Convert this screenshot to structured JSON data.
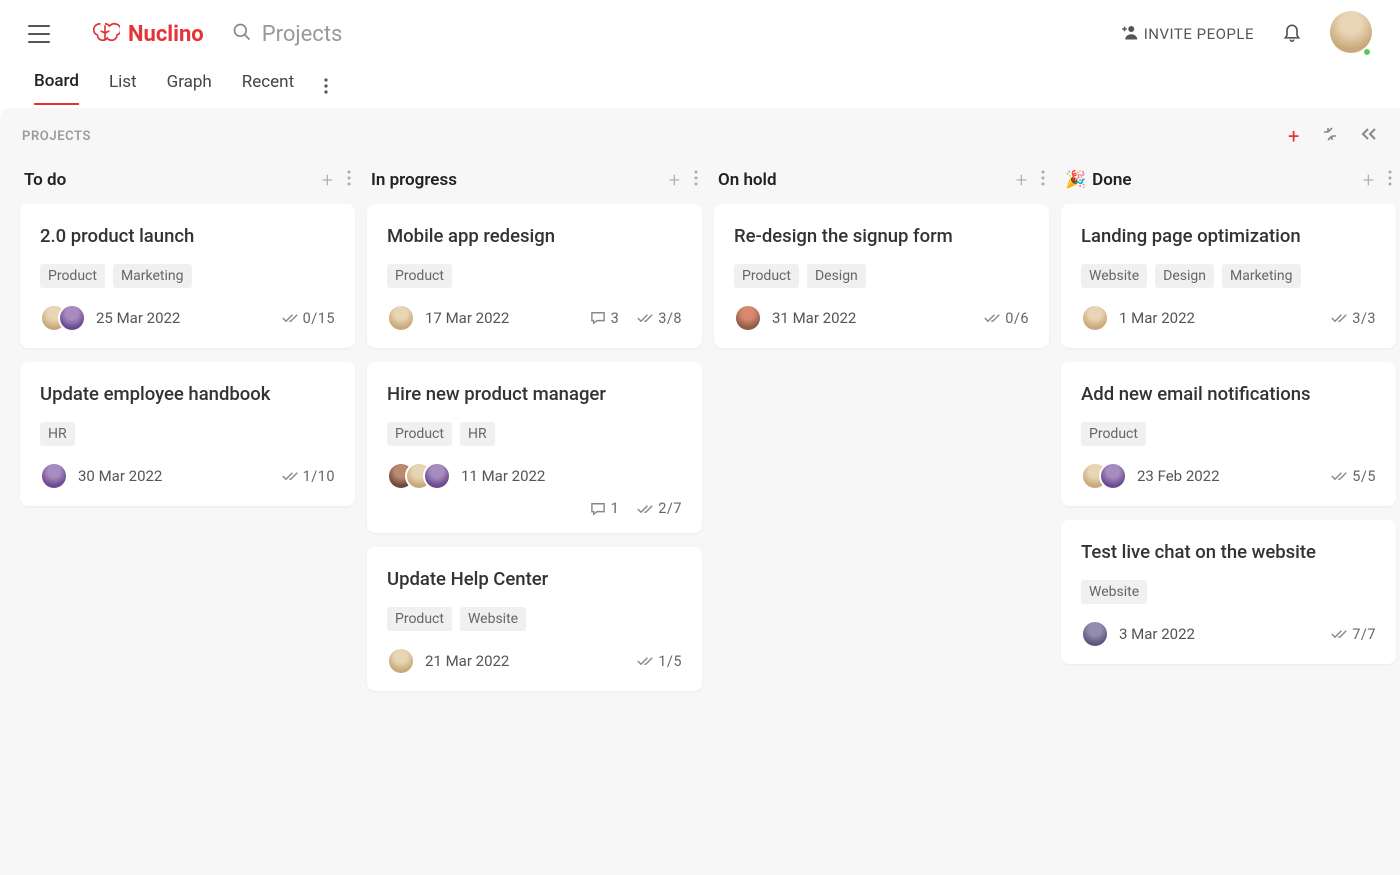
{
  "header": {
    "app_name": "Nuclino",
    "search_placeholder": "Projects",
    "invite_label": "INVITE PEOPLE"
  },
  "tabs": [
    "Board",
    "List",
    "Graph",
    "Recent"
  ],
  "active_tab": "Board",
  "board_label": "PROJECTS",
  "columns": [
    {
      "title": "To do",
      "emoji": "",
      "cards": [
        {
          "title": "2.0 product launch",
          "tags": [
            "Product",
            "Marketing"
          ],
          "avatars": [
            "av-1",
            "av-2"
          ],
          "date": "25 Mar 2022",
          "comments": null,
          "tasks": "0/15"
        },
        {
          "title": "Update employee handbook",
          "tags": [
            "HR"
          ],
          "avatars": [
            "av-2"
          ],
          "date": "30 Mar 2022",
          "comments": null,
          "tasks": "1/10"
        }
      ]
    },
    {
      "title": "In progress",
      "emoji": "",
      "cards": [
        {
          "title": "Mobile app redesign",
          "tags": [
            "Product"
          ],
          "avatars": [
            "av-1"
          ],
          "date": "17 Mar 2022",
          "comments": "3",
          "tasks": "3/8"
        },
        {
          "title": "Hire new product manager",
          "tags": [
            "Product",
            "HR"
          ],
          "avatars": [
            "av-3",
            "av-1",
            "av-2"
          ],
          "date": "11 Mar 2022",
          "comments": "1",
          "tasks": "2/7",
          "wrap": true
        },
        {
          "title": "Update Help Center",
          "tags": [
            "Product",
            "Website"
          ],
          "avatars": [
            "av-1"
          ],
          "date": "21 Mar 2022",
          "comments": null,
          "tasks": "1/5"
        }
      ]
    },
    {
      "title": "On hold",
      "emoji": "",
      "cards": [
        {
          "title": "Re-design the signup form",
          "tags": [
            "Product",
            "Design"
          ],
          "avatars": [
            "av-4"
          ],
          "date": "31 Mar 2022",
          "comments": null,
          "tasks": "0/6"
        }
      ]
    },
    {
      "title": "Done",
      "emoji": "🎉",
      "cards": [
        {
          "title": "Landing page optimization",
          "tags": [
            "Website",
            "Design",
            "Marketing"
          ],
          "avatars": [
            "av-1"
          ],
          "date": "1 Mar 2022",
          "comments": null,
          "tasks": "3/3"
        },
        {
          "title": "Add new email notifications",
          "tags": [
            "Product"
          ],
          "avatars": [
            "av-1",
            "av-2"
          ],
          "date": "23 Feb 2022",
          "comments": null,
          "tasks": "5/5"
        },
        {
          "title": "Test live chat on the website",
          "tags": [
            "Website"
          ],
          "avatars": [
            "av-5"
          ],
          "date": "3 Mar 2022",
          "comments": null,
          "tasks": "7/7"
        }
      ]
    }
  ]
}
